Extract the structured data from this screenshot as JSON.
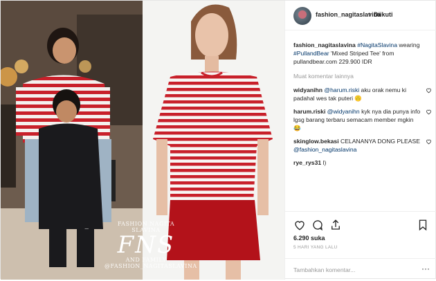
{
  "post": {
    "username": "fashion_nagitaslavina",
    "separator": "•",
    "follow_status": "Diikuti",
    "caption": {
      "user": "fashion_nagitaslavina",
      "hashtag_person": "#NagitaSlavina",
      "text1": " wearing ",
      "hashtag_brand": "#PullandBear",
      "text2": " 'Mixed Striped Tee' from pullandbear.com 229.900 IDR"
    },
    "load_more": "Muat komentar lainnya",
    "comments": [
      {
        "user": "widyanihn",
        "mention": "@harum.riski",
        "text": " aku orak nemu ki padahal wes tak puteri 🙃"
      },
      {
        "user": "harum.riski",
        "mention": "@widyanihn",
        "text": " kyk nya dia punya info lgsg barang terbaru semacam member mgkin 😂"
      },
      {
        "user": "skinglow.bekasi",
        "text_before": " CELANANYA DONG PLEASE ",
        "mention": "@fashion_nagitaslavina"
      },
      {
        "user": "rye_rys31",
        "text": " l)"
      }
    ],
    "likes": "6.290 suka",
    "time": "5 HARI YANG LALU",
    "add_comment_placeholder": "Tambahkan komentar...",
    "more_options": "···"
  },
  "watermark": {
    "line1": "FASHION NAGITA SLAVINA",
    "logo": "FNS",
    "line2": "AND FAMILY",
    "line3": "@FASHION_NAGITASLAVINA"
  },
  "icons": {
    "avatar": "profile-avatar",
    "like": "heart-icon",
    "comment": "comment-icon",
    "share": "share-icon",
    "save": "bookmark-icon"
  },
  "colors": {
    "link": "#003569",
    "stripe_red": "#c8202a",
    "skirt_red": "#b3121a",
    "muted": "#999999"
  }
}
